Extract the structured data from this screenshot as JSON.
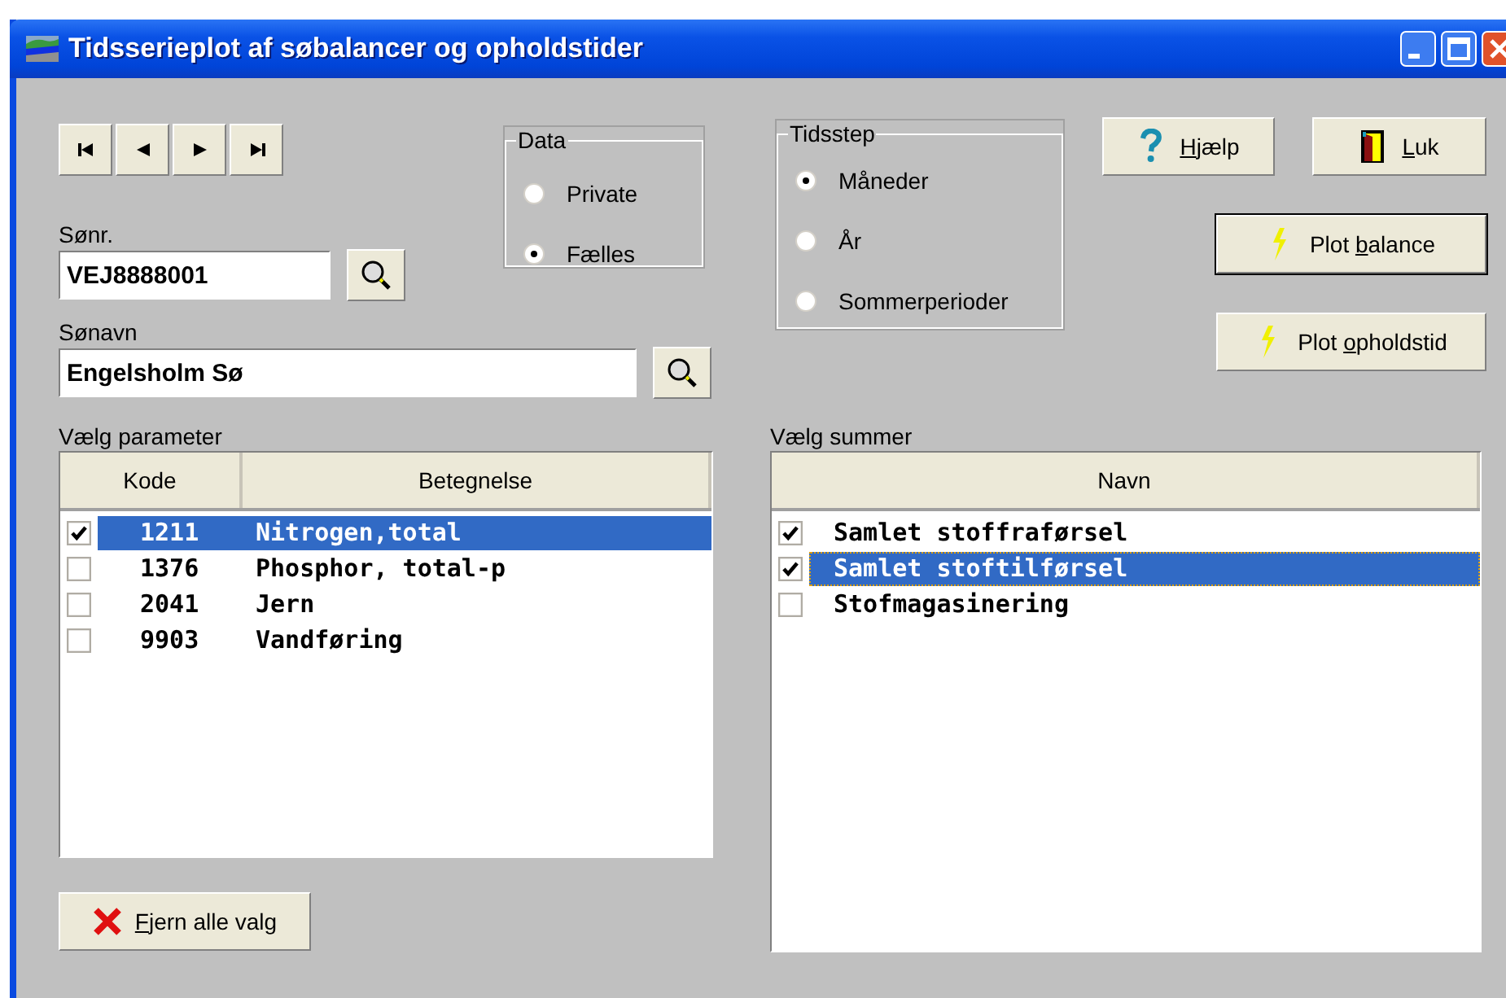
{
  "window": {
    "title": "Tidsserieplot af søbalancer og opholdstider"
  },
  "navigation": [
    {
      "kind": "first"
    },
    {
      "kind": "previous"
    },
    {
      "kind": "next"
    },
    {
      "kind": "last"
    }
  ],
  "lake_number": {
    "label": "Sønr.",
    "value": "VEJ8888001"
  },
  "lake_name": {
    "label": "Sønavn",
    "value": "Engelsholm Sø"
  },
  "data_group": {
    "title": "Data",
    "options": [
      {
        "label": "Private",
        "selected": false
      },
      {
        "label": "Fælles",
        "selected": true
      }
    ]
  },
  "timestep_group": {
    "title": "Tidsstep",
    "options": [
      {
        "label": "Måneder",
        "selected": true
      },
      {
        "label": "År",
        "selected": false
      },
      {
        "label": "Sommerperioder",
        "selected": false
      }
    ]
  },
  "buttons": [
    {
      "kind": "help",
      "key": "H",
      "post": "jælp",
      "default": false
    },
    {
      "kind": "close",
      "key": "L",
      "post": "uk",
      "default": false
    },
    {
      "kind": "plot",
      "pre": "Plot ",
      "key": "b",
      "post": "alance",
      "default": true
    },
    {
      "kind": "plot",
      "pre": "Plot ",
      "key": "o",
      "post": "pholdstid",
      "default": false
    }
  ],
  "parameter_list": {
    "label": "Vælg parameter",
    "columns": [
      "Kode",
      "Betegnelse"
    ],
    "rows": [
      {
        "code": "1211",
        "name": "Nitrogen,total",
        "checked": true,
        "selected": true
      },
      {
        "code": "1376",
        "name": "Phosphor, total-p",
        "checked": false,
        "selected": false
      },
      {
        "code": "2041",
        "name": "Jern",
        "checked": false,
        "selected": false
      },
      {
        "code": "9903",
        "name": "Vandføring",
        "checked": false,
        "selected": false
      }
    ]
  },
  "clear_button": {
    "key": "F",
    "post": "jern alle valg"
  },
  "sum_list": {
    "label": "Vælg summer",
    "columns": [
      "Navn"
    ],
    "rows": [
      {
        "name": "Samlet stoffraførsel",
        "checked": true,
        "selected": false
      },
      {
        "name": "Samlet stoftilførsel",
        "checked": true,
        "selected": true
      },
      {
        "name": "Stofmagasinering",
        "checked": false,
        "selected": false
      }
    ]
  }
}
